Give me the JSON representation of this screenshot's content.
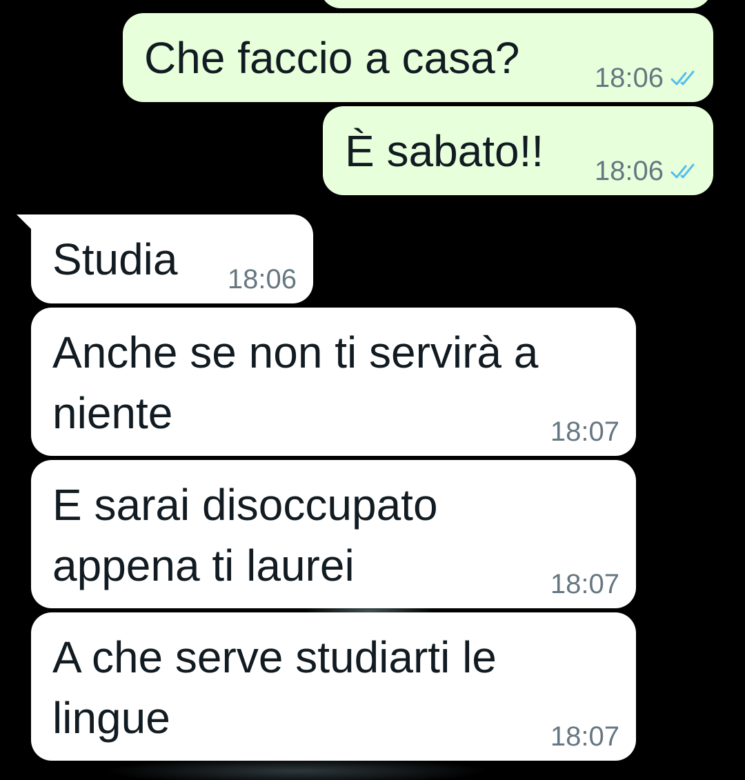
{
  "chat": {
    "messages": [
      {
        "direction": "outgoing",
        "lines": [
          ""
        ],
        "time": "",
        "read": true
      },
      {
        "direction": "outgoing",
        "lines": [
          "Che faccio a casa?"
        ],
        "time": "18:06",
        "read": true
      },
      {
        "direction": "outgoing",
        "lines": [
          "È sabato!!"
        ],
        "time": "18:06",
        "read": true
      },
      {
        "direction": "incoming",
        "lines": [
          "Studia"
        ],
        "time": "18:06"
      },
      {
        "direction": "incoming",
        "lines": [
          "Anche se non ti servirà a",
          "niente"
        ],
        "time": "18:07"
      },
      {
        "direction": "incoming",
        "lines": [
          "E sarai disoccupato",
          "appena ti laurei"
        ],
        "time": "18:07"
      },
      {
        "direction": "incoming",
        "lines": [
          "A che serve studiarti le",
          "lingue"
        ],
        "time": "18:07"
      }
    ]
  },
  "colors": {
    "background": "#000000",
    "outgoing_bubble": "#e7ffdb",
    "incoming_bubble": "#ffffff",
    "text": "#111b21",
    "timestamp": "#667781",
    "read_ticks": "#53bdeb"
  },
  "icons": {
    "read_receipt": "double-check-icon"
  }
}
